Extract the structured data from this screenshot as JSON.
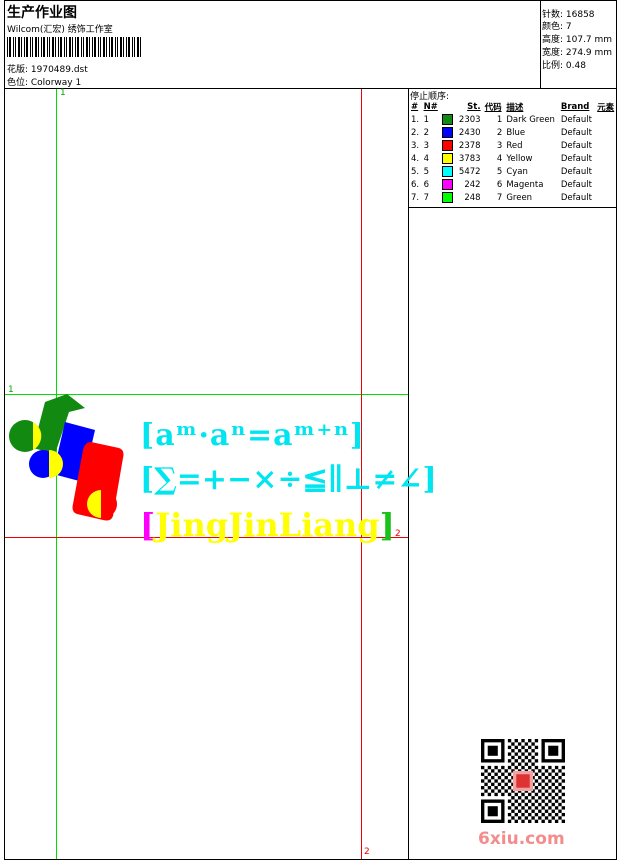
{
  "header": {
    "title": "生产作业图",
    "studio": "Wilcom(汇宏) 绣饰工作室",
    "design_file": "花版: 1970489.dst",
    "colorway": "色位: Colorway 1"
  },
  "stats": {
    "stitches": "针数: 16858",
    "colors": "颜色: 7",
    "height": "高度: 107.7 mm",
    "width": "宽度: 274.9 mm",
    "scale": "比例: 0.48"
  },
  "stop_sequence": {
    "title": "停止顺序:",
    "headers": [
      "#",
      "N#",
      "St.",
      "代码",
      "描述",
      "Brand",
      "元素"
    ],
    "rows": [
      {
        "idx": "1.",
        "n": "1",
        "color": "#128a12",
        "st": "2303",
        "code": "1",
        "desc": "Dark Green",
        "brand": "Default"
      },
      {
        "idx": "2.",
        "n": "2",
        "color": "#0000ff",
        "st": "2430",
        "code": "2",
        "desc": "Blue",
        "brand": "Default"
      },
      {
        "idx": "3.",
        "n": "3",
        "color": "#ff0000",
        "st": "2378",
        "code": "3",
        "desc": "Red",
        "brand": "Default"
      },
      {
        "idx": "4.",
        "n": "4",
        "color": "#ffff00",
        "st": "3783",
        "code": "4",
        "desc": "Yellow",
        "brand": "Default"
      },
      {
        "idx": "5.",
        "n": "5",
        "color": "#00ffff",
        "st": "5472",
        "code": "5",
        "desc": "Cyan",
        "brand": "Default"
      },
      {
        "idx": "6.",
        "n": "6",
        "color": "#ff00ff",
        "st": "242",
        "code": "6",
        "desc": "Magenta",
        "brand": "Default"
      },
      {
        "idx": "7.",
        "n": "7",
        "color": "#00ff00",
        "st": "248",
        "code": "7",
        "desc": "Green",
        "brand": "Default"
      }
    ]
  },
  "design": {
    "line1": "[aᵐ·aⁿ=aᵐ⁺ⁿ]",
    "line2": "[∑=+−×÷≦∥⊥≠∠]",
    "line3_open": "[",
    "line3_text": "JingJinLiang",
    "line3_close": "]"
  },
  "markers": {
    "top_green": "1",
    "left_green": "1",
    "right_red": "2",
    "bottom_red": "2"
  },
  "colors": {
    "guide_green": "#00dd00",
    "guide_red": "#ee0000"
  },
  "watermark": "6xiu.com"
}
